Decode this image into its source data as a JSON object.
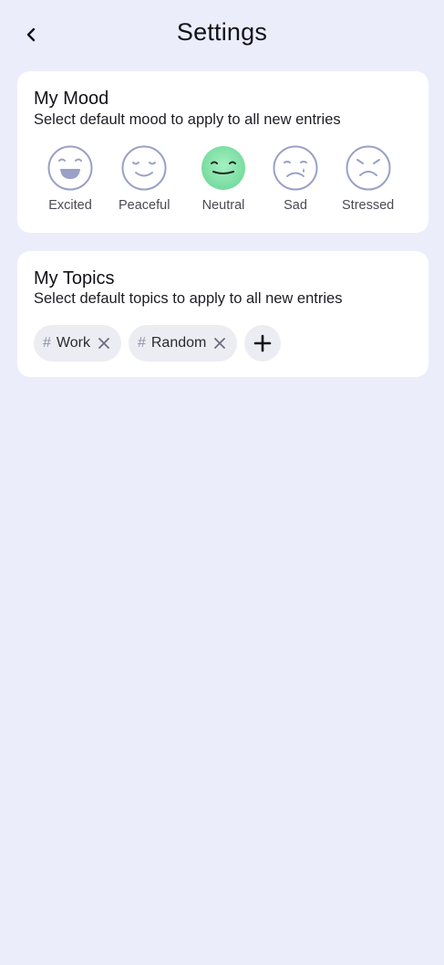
{
  "header": {
    "title": "Settings",
    "back_icon": "chevron-left-icon"
  },
  "mood_card": {
    "title": "My Mood",
    "subtitle": "Select default mood to apply to all new entries",
    "selected": "Neutral",
    "selected_color": "#7ee0a4",
    "outline_color": "#9aa0c6",
    "items": [
      {
        "label": "Excited",
        "icon": "excited-face-icon"
      },
      {
        "label": "Peaceful",
        "icon": "peaceful-face-icon"
      },
      {
        "label": "Neutral",
        "icon": "neutral-face-icon"
      },
      {
        "label": "Sad",
        "icon": "sad-face-icon"
      },
      {
        "label": "Stressed",
        "icon": "stressed-face-icon"
      }
    ]
  },
  "topics_card": {
    "title": "My Topics",
    "subtitle": "Select default topics to apply to all new entries",
    "chips": [
      {
        "hash": "#",
        "label": "Work",
        "remove_icon": "close-icon"
      },
      {
        "hash": "#",
        "label": "Random",
        "remove_icon": "close-icon"
      }
    ],
    "add_icon": "plus-icon"
  },
  "colors": {
    "background": "#ecedfb",
    "card": "#ffffff",
    "chip": "#ecedf3"
  }
}
